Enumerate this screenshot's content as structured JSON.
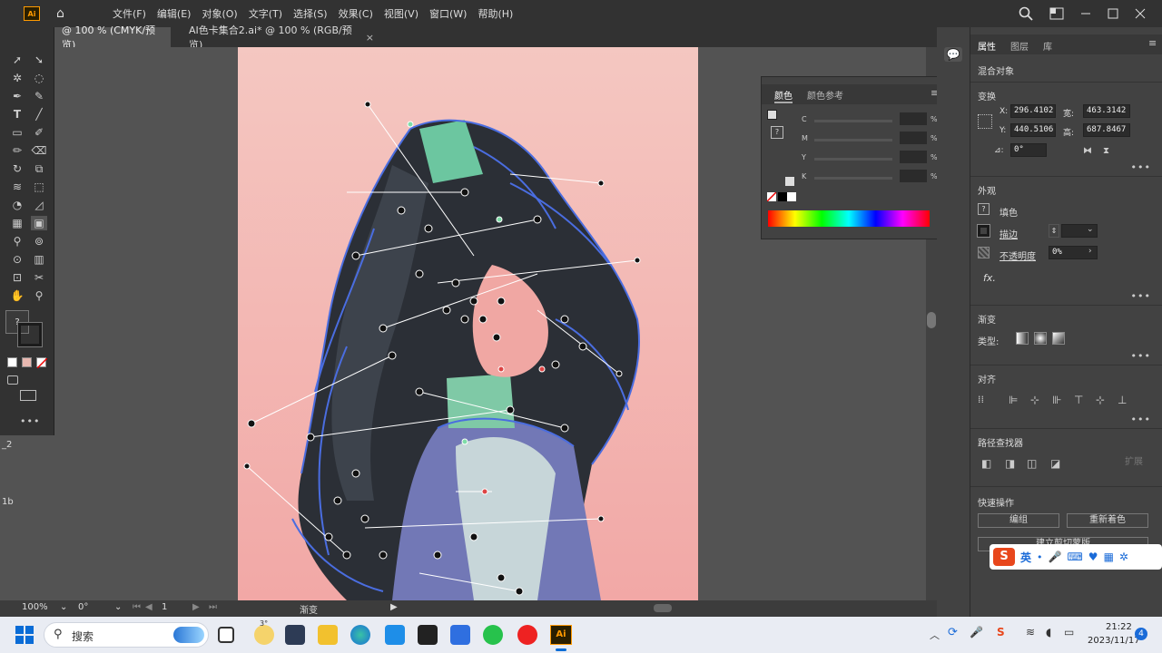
{
  "app": {
    "logo": "Ai"
  },
  "menu": [
    "文件(F)",
    "编辑(E)",
    "对象(O)",
    "文字(T)",
    "选择(S)",
    "效果(C)",
    "视图(V)",
    "窗口(W)",
    "帮助(H)"
  ],
  "tabs": [
    {
      "label": "@ 100 % (CMYK/预览)",
      "active": true
    },
    {
      "label": "AI色卡集合2.ai* @ 100 % (RGB/预览)",
      "active": false
    }
  ],
  "tab_close_glyph": "×",
  "toolbar": {
    "unknown_glyph": "?"
  },
  "left_margin_labels": [
    "_2",
    "1b"
  ],
  "color_panel": {
    "tabs": [
      "颜色",
      "颜色参考"
    ],
    "channels": [
      "C",
      "M",
      "Y",
      "K"
    ],
    "percent": "%",
    "unknown_glyph": "?"
  },
  "properties": {
    "tabs": [
      "属性",
      "图层",
      "库"
    ],
    "selection_type": "混合对象",
    "transform": {
      "title": "变换",
      "x_label": "X:",
      "x_value": "296.4102",
      "y_label": "Y:",
      "y_value": "440.5106",
      "w_label": "宽:",
      "w_value": "463.3142",
      "h_label": "高:",
      "h_value": "687.8467",
      "angle_label": "⊿:",
      "angle_value": "0°"
    },
    "appearance": {
      "title": "外观",
      "fill_label": "填色",
      "stroke_label": "描边",
      "opacity_label": "不透明度",
      "opacity_value": "0%",
      "fx": "fx."
    },
    "gradient": {
      "title": "渐变",
      "type_label": "类型:"
    },
    "align": {
      "title": "对齐"
    },
    "pathfinder": {
      "title": "路径查找器",
      "expand_label": "扩展"
    },
    "quick_actions": {
      "title": "快速操作",
      "group_label": "编组",
      "recolor_label": "重新着色",
      "clip_label": "建立剪切蒙版"
    },
    "more": "•••",
    "unknown_glyph": "?"
  },
  "statusbar": {
    "zoom": "100%",
    "rotation": "0°",
    "artboard_index": "1",
    "tool_name": "渐变"
  },
  "taskbar": {
    "search_placeholder": "搜索",
    "weather": "3°",
    "time": "21:22",
    "date": "2023/11/17",
    "notifications": "4"
  },
  "ime": {
    "lang": "英"
  }
}
